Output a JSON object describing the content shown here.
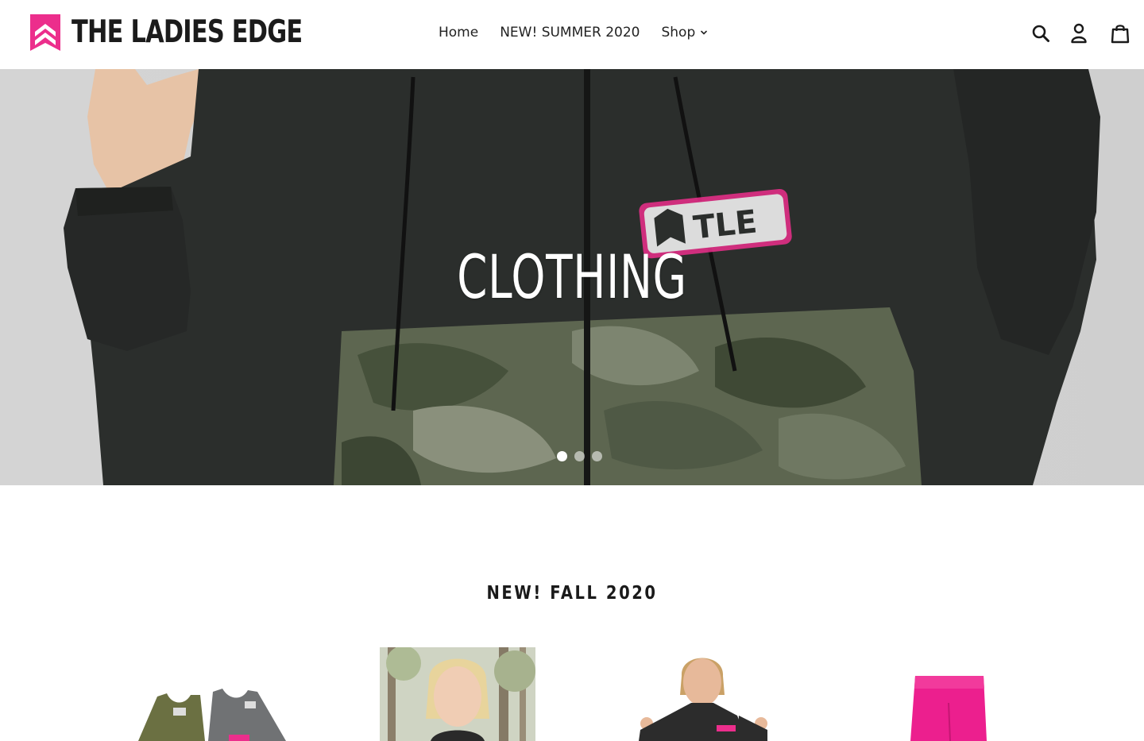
{
  "brand": {
    "name": "THE LADIES EDGE",
    "accent_color": "#ec2e8c"
  },
  "nav": {
    "items": [
      {
        "label": "Home"
      },
      {
        "label": "NEW! SUMMER 2020"
      },
      {
        "label": "Shop"
      }
    ]
  },
  "header_icons": [
    "search-icon",
    "account-icon",
    "cart-icon"
  ],
  "hero": {
    "title": "CLOTHING",
    "slides_count": 3,
    "active_slide": 1
  },
  "featured": {
    "title": "NEW! FALL 2020",
    "products": [
      {
        "image": "green-and-gray-tank-tops"
      },
      {
        "image": "woman-in-forest-photo"
      },
      {
        "image": "woman-holding-black-jacket"
      },
      {
        "image": "pink-biker-shorts"
      }
    ]
  }
}
